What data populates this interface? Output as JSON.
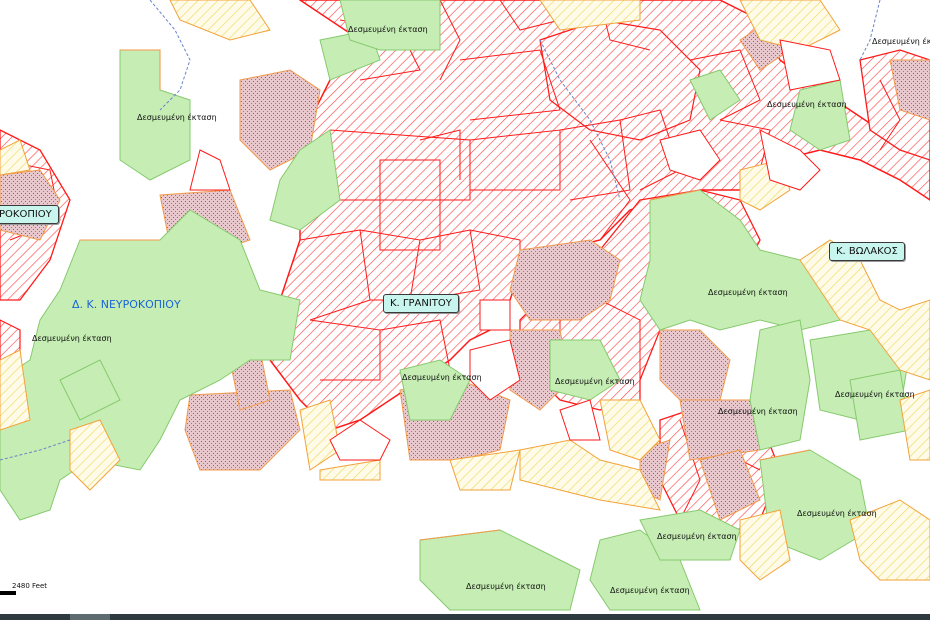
{
  "place_labels": [
    "ΡΟΚΟΠΙΟΥ",
    "Κ. ΒΩΛΑΚΟΣ",
    "Κ. ΓΡΑΝΙΤΟΥ"
  ],
  "district_label": "Δ. Κ. ΝΕΥΡΟΚΟΠΙΟΥ",
  "zone_label": "Δεσμευμένη έκταση",
  "scale_label": "2480 Feet",
  "colors": {
    "reserved_fill": "#c6eeb4",
    "reserved_border": "#86c96e",
    "parcel_outline": "#ff1a1a",
    "hatch_red": "#ff4a4a",
    "hatch_yellow": "#e8dc63",
    "stipple_fill": "#e8c8cc",
    "stream": "#6b84c8",
    "label_bg": "#c8f5ee"
  }
}
